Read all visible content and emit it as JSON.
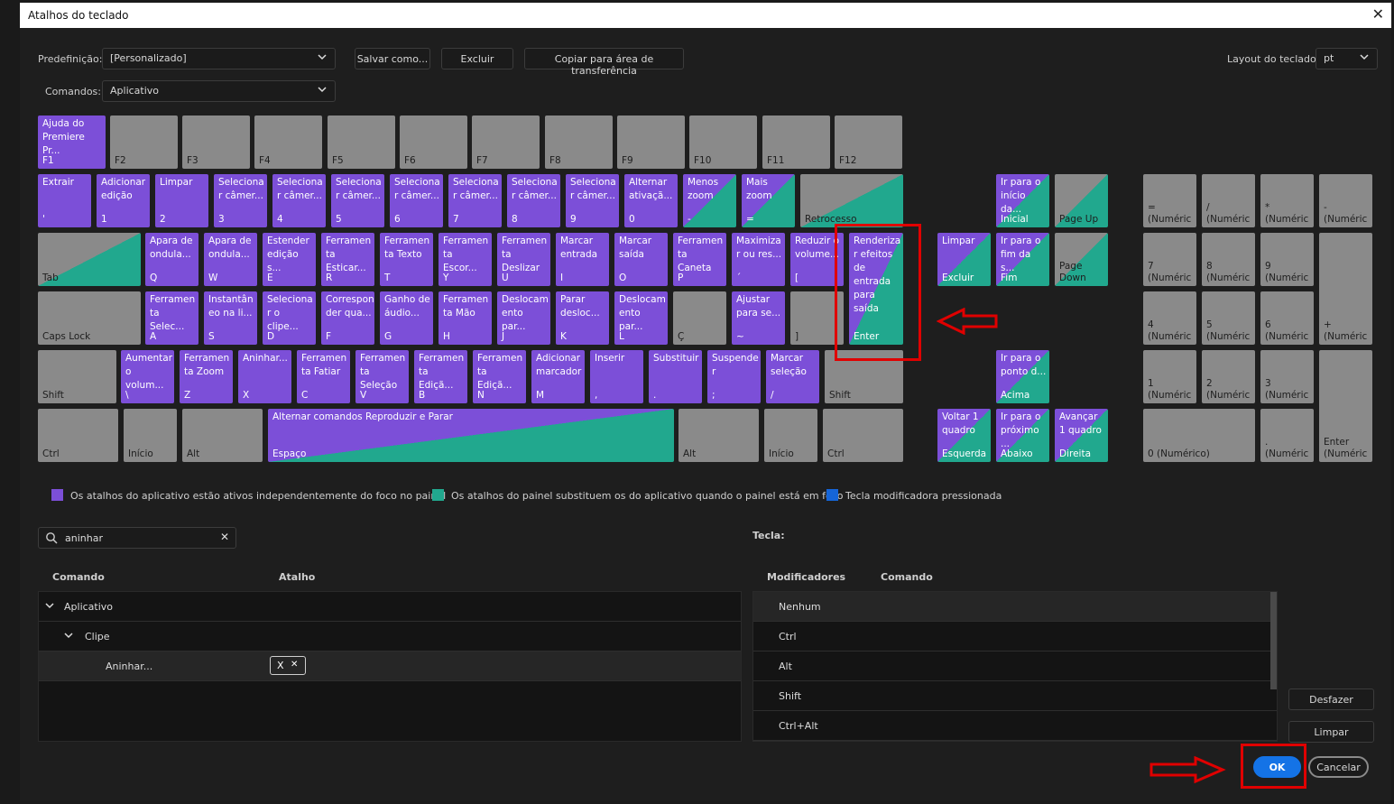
{
  "dialog": {
    "title": "Atalhos do teclado",
    "close_glyph": "✕"
  },
  "toolbar": {
    "preset_label": "Predefinição:",
    "preset_value": "[Personalizado]",
    "save_as": "Salvar como...",
    "delete": "Excluir",
    "copy_clipboard": "Copiar para área de transferência",
    "layout_label": "Layout do teclado:",
    "layout_value": "pt",
    "commands_label": "Comandos:",
    "commands_value": "Aplicativo"
  },
  "keys": {
    "f1_name": "Ajuda do Premiere Pr...",
    "f1": "F1",
    "f2": "F2",
    "f3": "F3",
    "f4": "F4",
    "f5": "F5",
    "f6": "F6",
    "f7": "F7",
    "f8": "F8",
    "f9": "F9",
    "f10": "F10",
    "f11": "F11",
    "f12": "F12",
    "r1": [
      {
        "n": "Extrair",
        "k": "'"
      },
      {
        "n": "Adicionar edição",
        "k": "1"
      },
      {
        "n": "Limpar",
        "k": "2"
      },
      {
        "n": "Seleciona r câmer...",
        "k": "3"
      },
      {
        "n": "Seleciona r câmer...",
        "k": "4"
      },
      {
        "n": "Seleciona r câmer...",
        "k": "5"
      },
      {
        "n": "Seleciona r câmer...",
        "k": "6"
      },
      {
        "n": "Seleciona r câmer...",
        "k": "7"
      },
      {
        "n": "Seleciona r câmer...",
        "k": "8"
      },
      {
        "n": "Seleciona r câmer...",
        "k": "9"
      },
      {
        "n": "Alternar ativaçã...",
        "k": "0"
      },
      {
        "n": "Menos zoom",
        "k": "-"
      },
      {
        "n": "Mais zoom",
        "k": "="
      }
    ],
    "backspace": "Retrocesso",
    "tab": "Tab",
    "r2": [
      {
        "n": "Apara de ondula...",
        "k": "Q"
      },
      {
        "n": "Apara de ondula...",
        "k": "W"
      },
      {
        "n": "Estender edição s...",
        "k": "E"
      },
      {
        "n": "Ferramen ta Esticar...",
        "k": "R"
      },
      {
        "n": "Ferramen ta Texto",
        "k": "T"
      },
      {
        "n": "Ferramen ta Escor...",
        "k": "Y"
      },
      {
        "n": "Ferramen ta Deslizar",
        "k": "U"
      },
      {
        "n": "Marcar entrada",
        "k": "I"
      },
      {
        "n": "Marcar saída",
        "k": "O"
      },
      {
        "n": "Ferramen ta Caneta",
        "k": "P"
      },
      {
        "n": "Maximiza r ou res...",
        "k": "´"
      },
      {
        "n": "Reduzir o volume...",
        "k": "["
      }
    ],
    "enter_name": "Renderiza r efeitos de entrada para saída",
    "enter": "Enter",
    "caps": "Caps Lock",
    "r3": [
      {
        "n": "Ferramen ta Selec...",
        "k": "A"
      },
      {
        "n": "Instantân eo na li...",
        "k": "S"
      },
      {
        "n": "Seleciona r o clipe...",
        "k": "D"
      },
      {
        "n": "Correspon der qua...",
        "k": "F"
      },
      {
        "n": "Ganho de áudio...",
        "k": "G"
      },
      {
        "n": "Ferramen ta Mão",
        "k": "H"
      },
      {
        "n": "Deslocam ento par...",
        "k": "J"
      },
      {
        "n": "Parar desloc...",
        "k": "K"
      },
      {
        "n": "Deslocam ento par...",
        "k": "L"
      }
    ],
    "c_cedilla": "Ç",
    "r3b_name": "Ajustar para se...",
    "r3b": "~",
    "bracket_r": "]",
    "shift": "Shift",
    "r4": [
      {
        "n": "Aumentar o volum...",
        "k": "\\"
      },
      {
        "n": "Ferramen ta Zoom",
        "k": "Z"
      },
      {
        "n": "Aninhar...",
        "k": "X"
      },
      {
        "n": "Ferramen ta Fatiar",
        "k": "C"
      },
      {
        "n": "Ferramen ta Seleção",
        "k": "V"
      },
      {
        "n": "Ferramen ta Ediçã...",
        "k": "B"
      },
      {
        "n": "Ferramen ta Ediçã...",
        "k": "N"
      },
      {
        "n": "Adicionar marcador",
        "k": "M"
      },
      {
        "n": "Inserir",
        "k": ","
      },
      {
        "n": "Substituir",
        "k": "."
      },
      {
        "n": "Suspende r",
        "k": ";"
      },
      {
        "n": "Marcar seleção",
        "k": "/"
      }
    ],
    "shift_r": "Shift",
    "ctrl": "Ctrl",
    "inicio": "Início",
    "alt": "Alt",
    "space_name": "Alternar comandos Reproduzir e Parar",
    "space": "Espaço",
    "alt_r": "Alt",
    "inicio_r": "Início",
    "ctrl_r": "Ctrl",
    "nav": {
      "home_name": "Ir para o início da...",
      "home": "Inicial",
      "pgup": "Page Up",
      "del_name": "Limpar",
      "del": "Excluir",
      "end_name": "Ir para o fim da s...",
      "end": "Fim",
      "pgdn": "Page Down",
      "up_name": "Ir para o ponto d...",
      "up": "Acima",
      "left_name": "Voltar 1 quadro",
      "left": "Esquerda",
      "down_name": "Ir para o próximo ...",
      "down": "Abaixo",
      "right_name": "Avançar 1 quadro",
      "right": "Direita"
    },
    "num": {
      "eq": "=",
      "div": "/",
      "mul": "*",
      "minus": "-",
      "n7": "7",
      "n8": "8",
      "n9": "9",
      "plus": "+",
      "n4": "4",
      "n5": "5",
      "n6": "6",
      "n1": "1",
      "n2": "2",
      "n3": "3",
      "n0": "0 (Numérico)",
      "dot": ".",
      "enter": "Enter",
      "suffix": "(Numéric"
    }
  },
  "legend": {
    "app": "Os atalhos do aplicativo estão ativos independentemente do foco no painel",
    "panel": "Os atalhos do painel substituem os do aplicativo quando o painel está em foco",
    "modifier": "Tecla modificadora pressionada",
    "app_color": "#7c4fd8",
    "panel_color": "#21a88e",
    "modifier_color": "#1565d8"
  },
  "search": {
    "value": "aninhar",
    "icon": "search-icon"
  },
  "list": {
    "col_command": "Comando",
    "col_shortcut": "Atalho",
    "group": "Aplicativo",
    "subgroup": "Clipe",
    "item": "Aninhar...",
    "shortcut_key": "X",
    "remove_glyph": "✕"
  },
  "key_panel": {
    "label": "Tecla:",
    "col_modifiers": "Modificadores",
    "col_command": "Comando",
    "rows": [
      "Nenhum",
      "Ctrl",
      "Alt",
      "Shift",
      "Ctrl+Alt"
    ]
  },
  "actions": {
    "undo": "Desfazer",
    "clear": "Limpar",
    "ok": "OK",
    "cancel": "Cancelar"
  }
}
